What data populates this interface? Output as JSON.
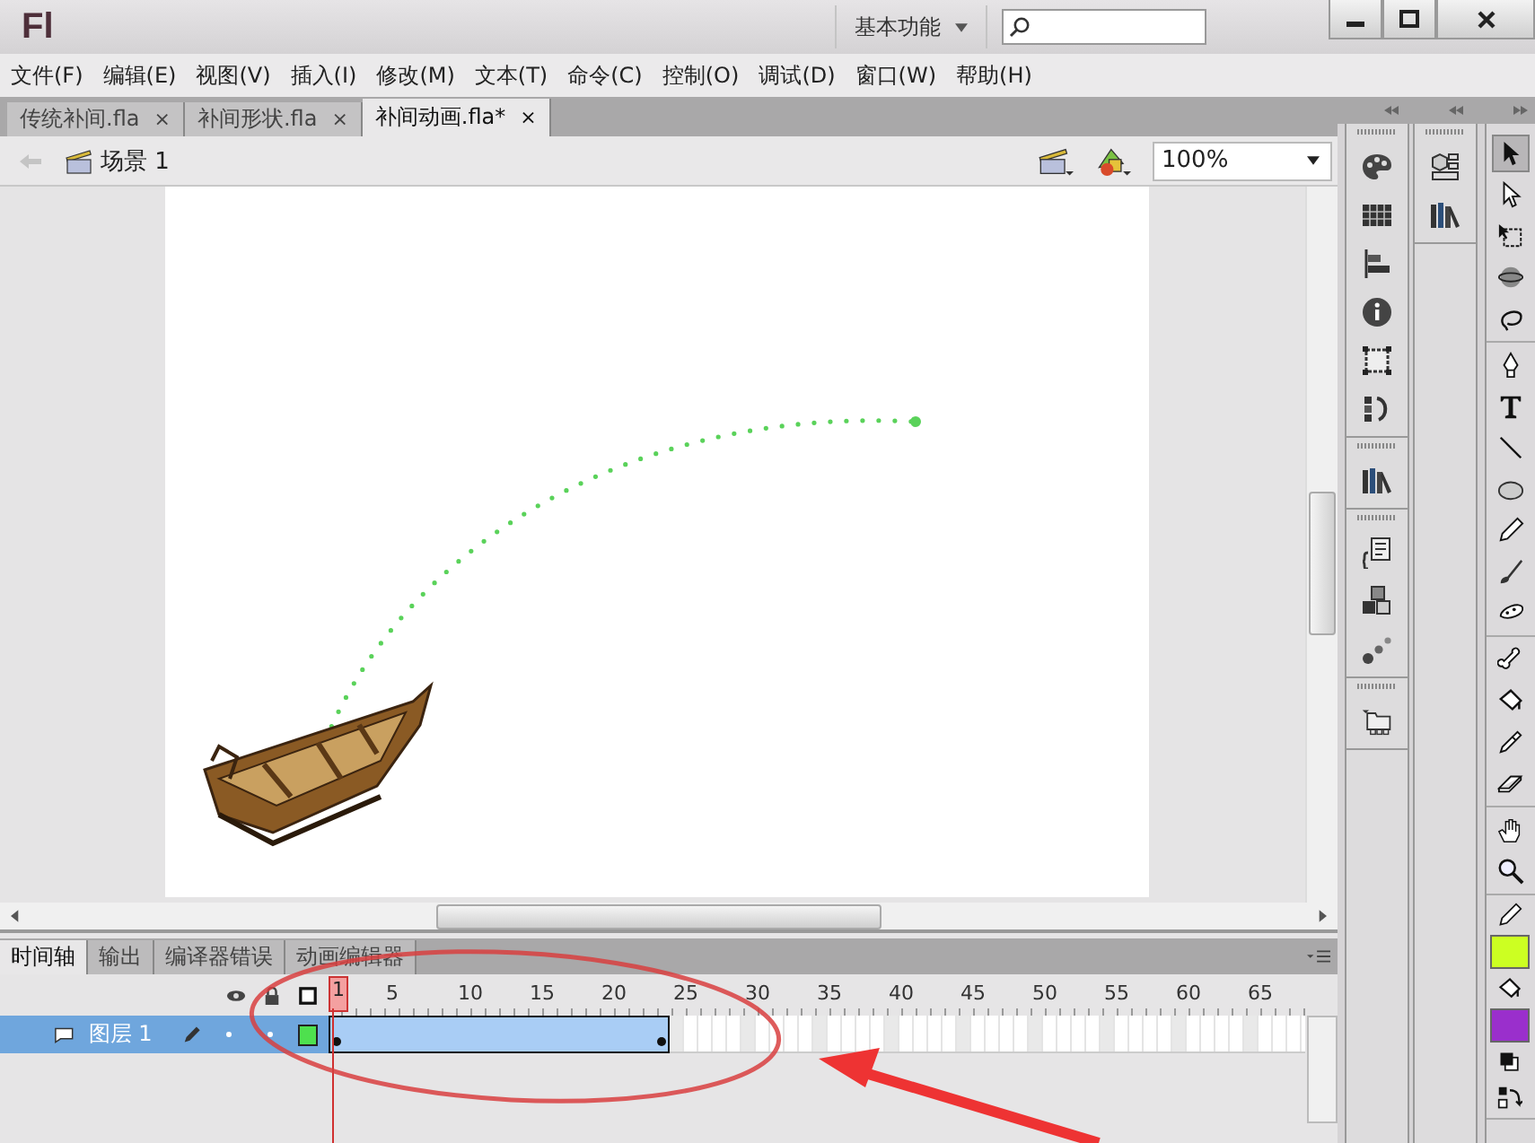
{
  "window": {
    "logo": "Fl",
    "workspace": "基本功能"
  },
  "menu": [
    "文件(F)",
    "编辑(E)",
    "视图(V)",
    "插入(I)",
    "修改(M)",
    "文本(T)",
    "命令(C)",
    "控制(O)",
    "调试(D)",
    "窗口(W)",
    "帮助(H)"
  ],
  "doc_tabs": [
    {
      "label": "传统补间.fla",
      "close": "×",
      "selected": false
    },
    {
      "label": "补间形状.fla",
      "close": "×",
      "selected": false
    },
    {
      "label": "补间动画.fla*",
      "close": "×",
      "selected": true
    }
  ],
  "scene": "场景 1",
  "zoom": "100%",
  "timeline": {
    "tabs": [
      {
        "label": "时间轴",
        "selected": true
      },
      {
        "label": "输出",
        "selected": false
      },
      {
        "label": "编译器错误",
        "selected": false
      },
      {
        "label": "动画编辑器",
        "selected": false
      }
    ],
    "frame_numbers": [
      "1",
      "5",
      "10",
      "15",
      "20",
      "25",
      "30",
      "35",
      "40",
      "45",
      "50",
      "55",
      "60",
      "65"
    ],
    "layers": [
      {
        "name": "图层 1",
        "selected": true,
        "color": "#4ee04e",
        "tween": {
          "level": 0.35
        }
      }
    ]
  },
  "tool_groups": [
    [
      {
        "kind": "selection",
        "selected": true
      },
      {
        "kind": "subselection",
        "selected": false
      },
      {
        "kind": "transform",
        "selected": false
      },
      {
        "kind": "rotation",
        "selected": false
      },
      {
        "kind": "lasso",
        "selected": false
      }
    ],
    [
      {
        "kind": "pen",
        "selected": false
      },
      {
        "kind": "text",
        "selected": false
      },
      {
        "kind": "line",
        "selected": false
      },
      {
        "kind": "oval",
        "selected": false
      },
      {
        "kind": "pencil",
        "selected": false
      },
      {
        "kind": "brush",
        "selected": false
      },
      {
        "kind": "deco",
        "selected": false
      }
    ],
    [
      {
        "kind": "bone",
        "selected": false
      },
      {
        "kind": "bucket",
        "selected": false
      },
      {
        "kind": "eyedropper",
        "selected": false
      },
      {
        "kind": "eraser",
        "selected": false
      }
    ],
    [
      {
        "kind": "hand",
        "selected": false
      },
      {
        "kind": "zoom",
        "selected": false
      }
    ]
  ],
  "colors": [
    {
      "kind": "stroke",
      "color": "#ccff22"
    },
    {
      "kind": "fill",
      "color": "#9a2fcc"
    }
  ]
}
